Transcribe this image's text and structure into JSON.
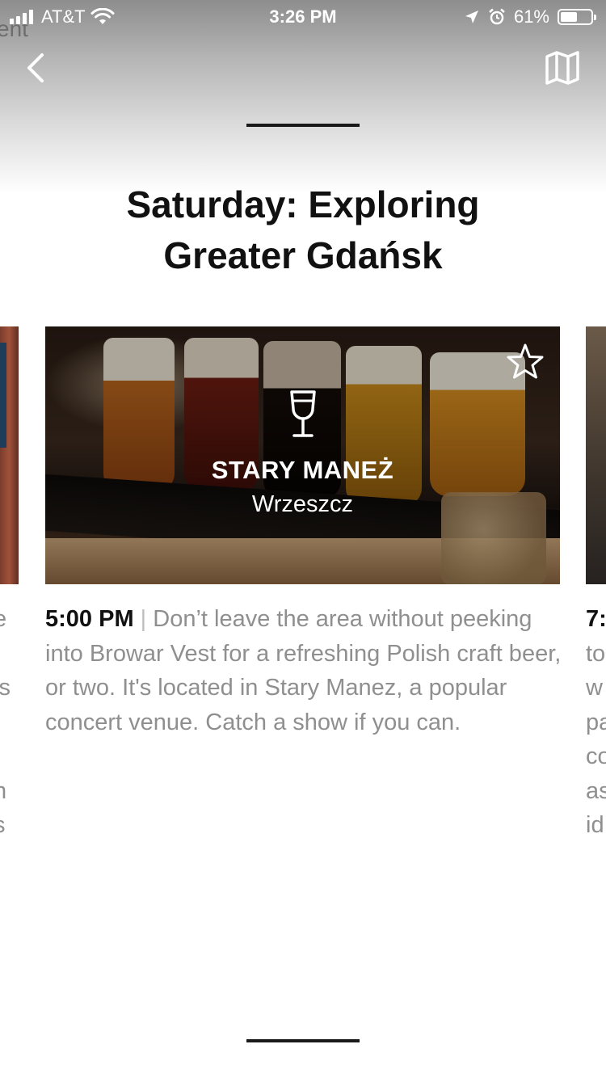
{
  "status_bar": {
    "carrier": "AT&T",
    "time": "3:26 PM",
    "battery": "61%",
    "battery_level": 0.61
  },
  "ghost_text": "ent",
  "nav": {
    "back_icon": "chevron-left-icon",
    "map_icon": "map-icon"
  },
  "page_title": "Saturday: Exploring Greater Gdańsk",
  "card": {
    "name": "STARY MANEŻ",
    "area": "Wrzeszcz",
    "icon": "wine-glass-icon",
    "favorite_icon": "star-outline-icon"
  },
  "description": {
    "time": "5:00 PM",
    "separator": "|",
    "text": "Don’t leave the area without peeking into Browar Vest for a refreshing Polish craft beer, or two. It's located in Stary Manez, a popular concert venue. Catch a show if you can."
  },
  "left_fragments": [
    "e",
    "",
    "ls",
    "",
    "",
    "n",
    "s"
  ],
  "right_fragments": [
    "7:",
    "to",
    "w",
    "pa",
    "co",
    "as",
    "id"
  ],
  "colors": {
    "title": "#111111",
    "body_text": "#8f8f8f",
    "header_gradient_top": "#8d8d8d"
  }
}
